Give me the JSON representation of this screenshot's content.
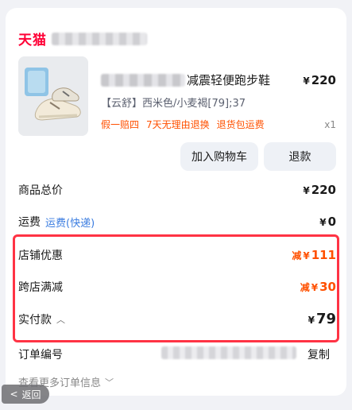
{
  "store": {
    "logo_text": "天猫"
  },
  "product": {
    "title_suffix": "减震轻便跑步鞋",
    "price": "220",
    "currency": "¥",
    "sku": "【云舒】西米色/小麦褐[79];37",
    "promos": [
      "假一赔四",
      "7天无理由退换",
      "退货包运费"
    ],
    "quantity": "x1"
  },
  "actions": {
    "add_to_cart": "加入购物车",
    "refund": "退款"
  },
  "summary": {
    "total_label": "商品总价",
    "total_value": "220",
    "shipping_label": "运费",
    "shipping_sub": "运费(快递)",
    "shipping_value": "0",
    "store_discount_label": "店铺优惠",
    "store_discount_prefix": "减",
    "store_discount_value": "111",
    "cross_store_label": "跨店满减",
    "cross_store_prefix": "减",
    "cross_store_value": "30",
    "paid_label": "实付款",
    "paid_value": "79"
  },
  "order": {
    "number_label": "订单编号",
    "copy_label": "复制",
    "more_label": "查看更多订单信息"
  },
  "nav": {
    "back_label": "返回"
  },
  "colors": {
    "brand": "#ff0036",
    "accent": "#ff5000",
    "link": "#3a7ce0",
    "highlight": "#ff3344"
  }
}
